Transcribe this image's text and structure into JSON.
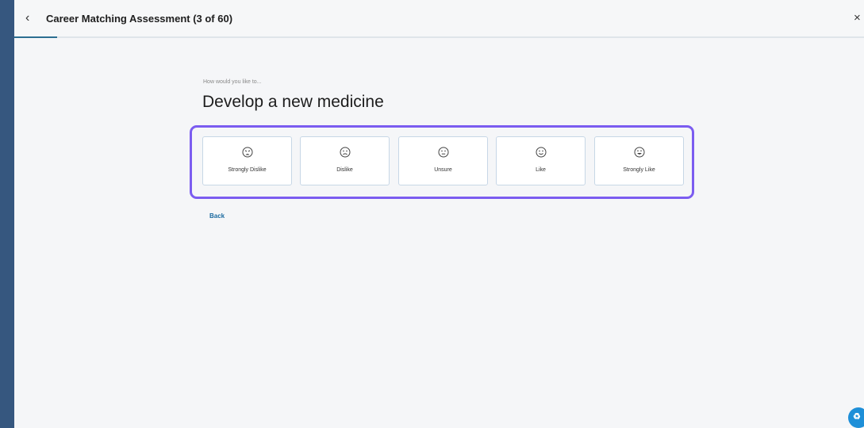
{
  "header": {
    "title": "Career Matching Assessment (3 of 60)",
    "back_icon": "chevron-left-icon",
    "close_glyph": "×",
    "progress_fraction": 0.05
  },
  "question": {
    "prompt": "How would you like to...",
    "text": "Develop a new medicine"
  },
  "options": [
    {
      "label": "Strongly Dislike",
      "icon": "very-sad-face-icon"
    },
    {
      "label": "Dislike",
      "icon": "sad-face-icon"
    },
    {
      "label": "Unsure",
      "icon": "neutral-face-icon"
    },
    {
      "label": "Like",
      "icon": "smile-face-icon"
    },
    {
      "label": "Strongly Like",
      "icon": "big-smile-face-icon"
    }
  ],
  "back_link": "Back",
  "colors": {
    "accent": "#7b5cf0",
    "link": "#1a6aa0",
    "background": "#36577f"
  }
}
